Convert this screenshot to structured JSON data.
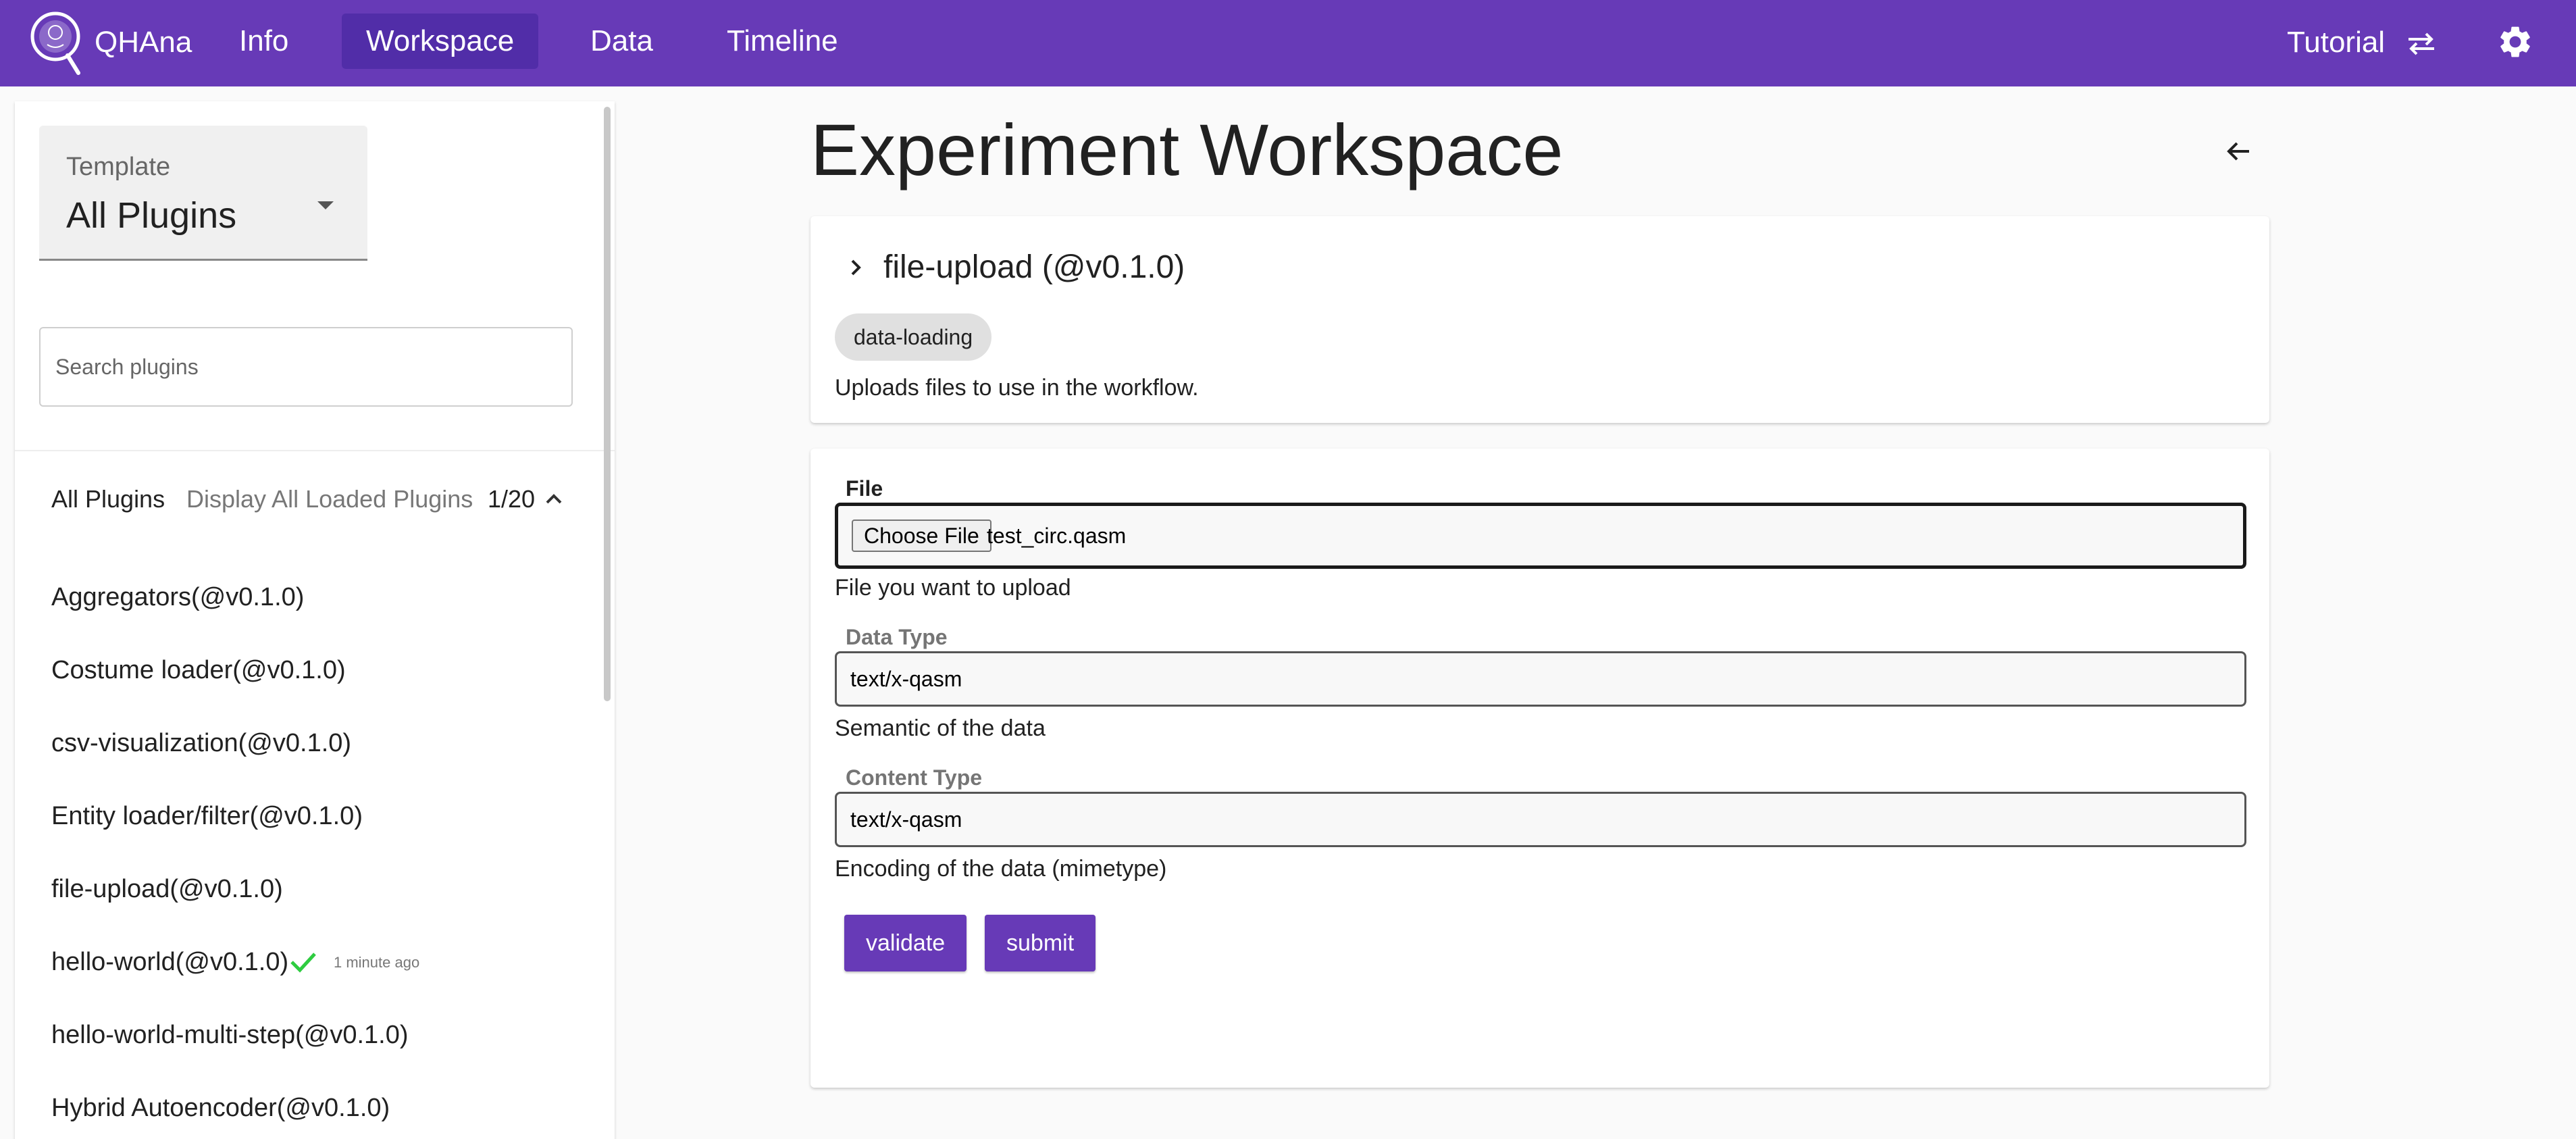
{
  "appbar": {
    "brand": "QHAna",
    "nav": [
      {
        "label": "Info"
      },
      {
        "label": "Workspace"
      },
      {
        "label": "Data"
      },
      {
        "label": "Timeline"
      }
    ],
    "tutorial_label": "Tutorial",
    "bar_color": "#673ab7",
    "active_color": "#512da8"
  },
  "sidebar": {
    "template_label": "Template",
    "template_value": "All Plugins",
    "search_placeholder": "Search plugins",
    "list_header": {
      "title": "All Plugins",
      "subtitle": "Display All Loaded Plugins",
      "count": "1/20"
    },
    "plugins": [
      {
        "label": "Aggregators(@v0.1.0)"
      },
      {
        "label": "Costume loader(@v0.1.0)"
      },
      {
        "label": "csv-visualization(@v0.1.0)"
      },
      {
        "label": "Entity loader/filter(@v0.1.0)"
      },
      {
        "label": "file-upload(@v0.1.0)"
      },
      {
        "label": "hello-world(@v0.1.0)",
        "status_icon": "check-icon",
        "status_time": "1 minute ago"
      },
      {
        "label": "hello-world-multi-step(@v0.1.0)"
      },
      {
        "label": "Hybrid Autoencoder(@v0.1.0)"
      }
    ]
  },
  "main": {
    "title": "Experiment Workspace",
    "plugin_card": {
      "title": "file-upload (@v0.1.0)",
      "tag": "data-loading",
      "description": "Uploads files to use in the workflow."
    },
    "form": {
      "file": {
        "label": "File",
        "button_label": "Choose File",
        "file_name": "test_circ.qasm",
        "helper": "File you want to upload"
      },
      "data_type": {
        "label": "Data Type",
        "value": "text/x-qasm",
        "helper": "Semantic of the data"
      },
      "content_type": {
        "label": "Content Type",
        "value": "text/x-qasm",
        "helper": "Encoding of the data (mimetype)"
      },
      "validate_label": "validate",
      "submit_label": "submit"
    }
  },
  "colors": {
    "accent": "#673ab7",
    "success": "#2ecc40"
  }
}
